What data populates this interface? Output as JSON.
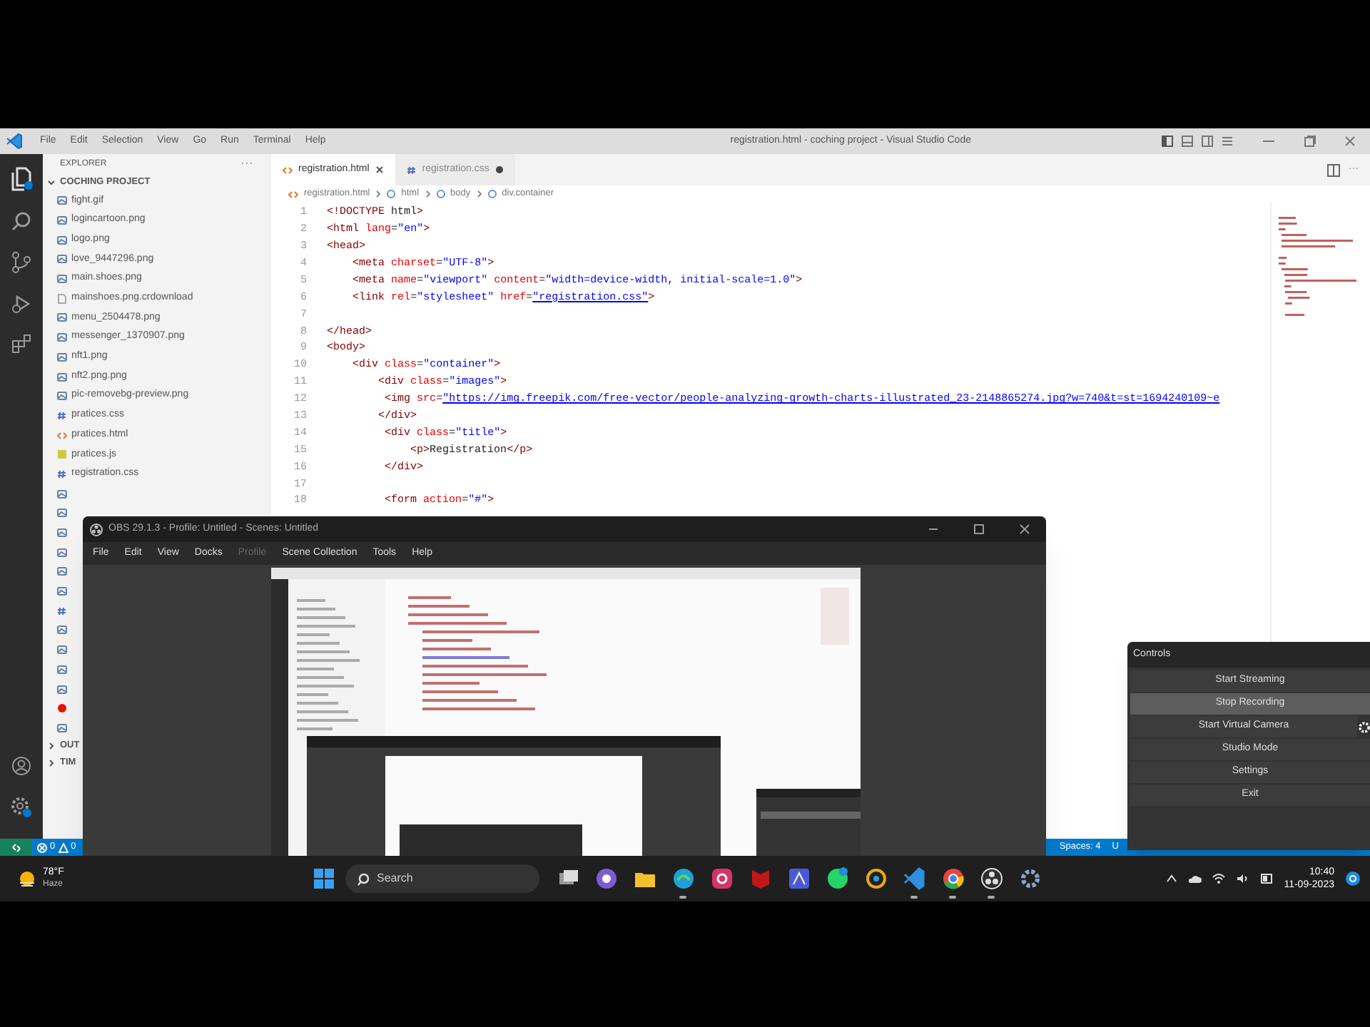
{
  "vscode": {
    "title": "registration.html - coching project - Visual Studio Code",
    "menu": [
      "File",
      "Edit",
      "Selection",
      "View",
      "Go",
      "Run",
      "Terminal",
      "Help"
    ],
    "explorer": {
      "title": "EXPLORER",
      "project": "COCHING PROJECT",
      "files": [
        {
          "name": "fight.gif",
          "kind": "image"
        },
        {
          "name": "logincartoon.png",
          "kind": "image"
        },
        {
          "name": "logo.png",
          "kind": "image"
        },
        {
          "name": "love_9447296.png",
          "kind": "image"
        },
        {
          "name": "main.shoes.png",
          "kind": "image"
        },
        {
          "name": "mainshoes.png.crdownload",
          "kind": "file"
        },
        {
          "name": "menu_2504478.png",
          "kind": "image"
        },
        {
          "name": "messenger_1370907.png",
          "kind": "image"
        },
        {
          "name": "nft1.png",
          "kind": "image"
        },
        {
          "name": "nft2.png.png",
          "kind": "image"
        },
        {
          "name": "pic-removebg-preview.png",
          "kind": "image"
        },
        {
          "name": "pratices.css",
          "kind": "css"
        },
        {
          "name": "pratices.html",
          "kind": "html"
        },
        {
          "name": "pratices.js",
          "kind": "js"
        },
        {
          "name": "registration.css",
          "kind": "css"
        }
      ],
      "hidden_rows": [
        {
          "kind": "image"
        },
        {
          "kind": "image"
        },
        {
          "kind": "image"
        },
        {
          "kind": "image"
        },
        {
          "kind": "image"
        },
        {
          "kind": "image"
        },
        {
          "kind": "css"
        },
        {
          "kind": "image"
        },
        {
          "kind": "image"
        },
        {
          "kind": "image"
        },
        {
          "kind": "image"
        },
        {
          "kind": "error"
        },
        {
          "kind": "image"
        }
      ],
      "actions": "···",
      "sections": [
        "OUT",
        "TIM"
      ]
    },
    "tabs": [
      {
        "label": "registration.html",
        "kind": "html",
        "selected": true,
        "modified": false
      },
      {
        "label": "registration.css",
        "kind": "css",
        "selected": false,
        "modified": true
      }
    ],
    "editor_actions": "···",
    "breadcrumb": [
      "registration.html",
      "html",
      "body",
      "div.container"
    ],
    "lines": [
      {
        "number": "1",
        "code": "<!DOCTYPE html>"
      },
      {
        "number": "2",
        "code": "<html lang=\"en\">"
      },
      {
        "number": "3",
        "code": "<head>"
      },
      {
        "number": "4",
        "code": "    <meta charset=\"UTF-8\">"
      },
      {
        "number": "5",
        "code": "    <meta name=\"viewport\" content=\"width=device-width, initial-scale=1.0\">"
      },
      {
        "number": "6",
        "code": "    <link rel=\"stylesheet\" href=\"registration.css\">"
      },
      {
        "number": "7"
      },
      {
        "number": "8",
        "code": "</head>"
      },
      {
        "number": "9",
        "code": "<body>"
      },
      {
        "number": "10",
        "code": "    <div class=\"container\">"
      },
      {
        "number": "11",
        "code": "        <div class=\"images\">"
      },
      {
        "number": "12",
        "code": "         <img src=\"https://img.freepik.com/free-vector/people-analyzing-growth-charts-illustrated_23-2148865274.jpg?w=740&t=st=1694240109~e"
      },
      {
        "number": "13",
        "code": "        </div>"
      },
      {
        "number": "14",
        "code": "         <div class=\"title\">"
      },
      {
        "number": "15",
        "code": "             <p>Registration</p>"
      },
      {
        "number": "16",
        "code": "         </div>"
      },
      {
        "number": "17"
      },
      {
        "number": "18",
        "code": "         <form action=\"#\">"
      }
    ],
    "status_bar": {
      "errors": "0",
      "warnings": "0",
      "spaces": "Spaces: 4",
      "encoding": "U"
    }
  },
  "obs": {
    "title": "OBS 29.1.3 - Profile: Untitled - Scenes: Untitled",
    "menu": [
      {
        "label": "File",
        "disabled": false
      },
      {
        "label": "Edit",
        "disabled": false
      },
      {
        "label": "View",
        "disabled": false
      },
      {
        "label": "Docks",
        "disabled": false
      },
      {
        "label": "Profile",
        "disabled": true
      },
      {
        "label": "Scene Collection",
        "disabled": false
      },
      {
        "label": "Tools",
        "disabled": false
      },
      {
        "label": "Help",
        "disabled": false
      }
    ],
    "controls": {
      "title": "Controls",
      "buttons": [
        {
          "label": "Start Streaming",
          "selected": false,
          "settings": false
        },
        {
          "label": "Stop Recording",
          "selected": true,
          "settings": false
        },
        {
          "label": "Start Virtual Camera",
          "selected": false,
          "settings": true
        },
        {
          "label": "Studio Mode",
          "selected": false,
          "settings": false
        },
        {
          "label": "Settings",
          "selected": false,
          "settings": false
        },
        {
          "label": "Exit",
          "selected": false,
          "settings": false
        }
      ]
    }
  },
  "taskbar": {
    "weather": {
      "temp": "78°F",
      "condition": "Haze"
    },
    "search": "Search",
    "apps": [
      {
        "kind": "task-view",
        "running": false
      },
      {
        "kind": "chat",
        "running": false
      },
      {
        "kind": "folder",
        "running": false
      },
      {
        "kind": "edge",
        "running": true
      },
      {
        "kind": "instagram",
        "running": false
      },
      {
        "kind": "mcafee",
        "running": false
      },
      {
        "kind": "editor",
        "running": false
      },
      {
        "kind": "whatsapp",
        "running": false
      },
      {
        "kind": "photos",
        "running": false
      },
      {
        "kind": "vscode",
        "running": true
      },
      {
        "kind": "chrome",
        "running": true
      },
      {
        "kind": "obs",
        "running": true
      },
      {
        "kind": "settings",
        "running": false
      }
    ],
    "time": "10:40",
    "date": "11-09-2023"
  }
}
